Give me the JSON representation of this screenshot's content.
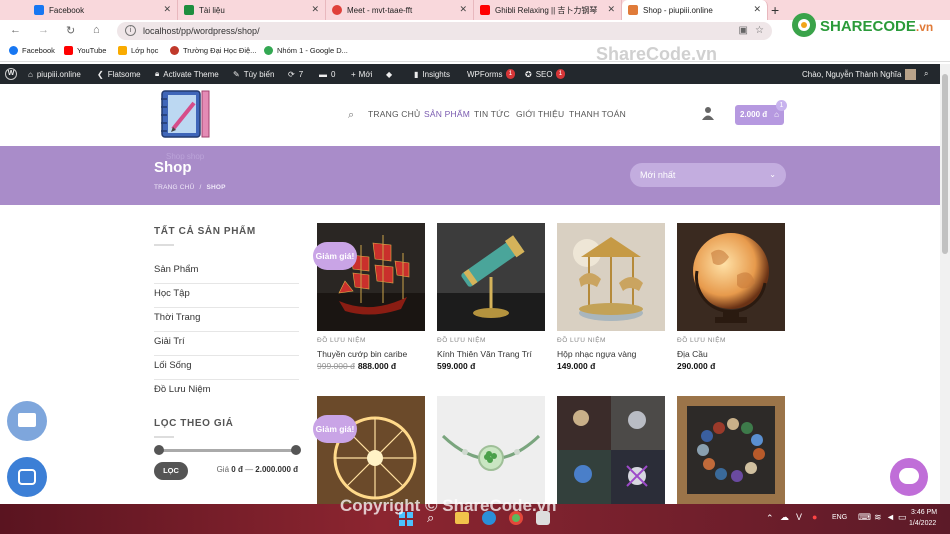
{
  "browser": {
    "tabs": [
      {
        "label": "Facebook",
        "color": "#1877f2"
      },
      {
        "label": "Tài liệu",
        "color": "#1e8e3e"
      },
      {
        "label": "Meet - mvt-taae-fft",
        "color": "#e0403a"
      },
      {
        "label": "Ghibli Relaxing || 吉卜力钢琴",
        "color": "#ff0000"
      },
      {
        "label": "Shop - piupiii.online",
        "color": "#e07b39"
      }
    ],
    "url": "localhost/pp/wordpress/shop/",
    "bookmarks": [
      {
        "label": "Facebook",
        "color": "#1877f2"
      },
      {
        "label": "YouTube",
        "color": "#ff0000"
      },
      {
        "label": "Lớp học",
        "color": "#f9ab00"
      },
      {
        "label": "Trường Đại Học Điệ...",
        "color": "#c0392b"
      },
      {
        "label": "Nhóm 1 - Google D...",
        "color": "#34a853"
      }
    ]
  },
  "wpadmin": {
    "site": "piupiii.online",
    "flatsome": "Flatsome",
    "activate": "Activate Theme",
    "customize": "Tùy biến",
    "updates": "7",
    "comments": "0",
    "new": "Mới",
    "insights": "Insights",
    "wpforms": "WPForms",
    "wpforms_count": "1",
    "seo": "SEO",
    "seo_count": "1",
    "greeting": "Chào, Nguyễn Thành Nghĩa"
  },
  "header": {
    "nav": [
      "TRANG CHỦ",
      "SẢN PHẨM",
      "TIN TỨC",
      "GIỚI THIỆU",
      "THANH TOÁN"
    ],
    "cart_total": "2.000 đ",
    "cart_count": "1"
  },
  "banner": {
    "bg_text": "Shop shop",
    "title": "Shop",
    "breadcrumb_home": "TRANG CHỦ",
    "breadcrumb_sep": "/",
    "breadcrumb_current": "SHOP",
    "sort_value": "Mới nhất"
  },
  "sidebar": {
    "categories_title": "TẤT CẢ SẢN PHẨM",
    "categories": [
      "Sản Phẩm",
      "Học Tập",
      "Thời Trang",
      "Giải Trí",
      "Lối Sống",
      "Đồ Lưu Niệm"
    ],
    "filter_title": "LỌC THEO GIÁ",
    "filter_button": "LỌC",
    "price_label": "Giá",
    "price_min": "0 đ",
    "price_dash": "—",
    "price_max": "2.000.000 đ"
  },
  "products": [
    {
      "category": "ĐỒ LƯU NIỆM",
      "name": "Thuyền cướp bin caribe",
      "old_price": "999.000 đ",
      "price": "888.000 đ",
      "sale": "Giảm giá!"
    },
    {
      "category": "ĐỒ LƯU NIỆM",
      "name": "Kính Thiên Văn Trang Trí",
      "old_price": "",
      "price": "599.000 đ",
      "sale": ""
    },
    {
      "category": "ĐỒ LƯU NIỆM",
      "name": "Hộp nhạc ngựa vàng",
      "old_price": "",
      "price": "149.000 đ",
      "sale": ""
    },
    {
      "category": "ĐỒ LƯU NIỆM",
      "name": "Địa Cầu",
      "old_price": "",
      "price": "290.000 đ",
      "sale": ""
    },
    {
      "sale": "Giảm giá!"
    }
  ],
  "taskbar": {
    "lang": "ENG",
    "time": "3:46 PM",
    "date": "1/4/2022"
  },
  "watermark": {
    "top": "ShareCode.vn",
    "bottom": "Copyright © ShareCode.vn",
    "logo": "SHARECODE.vn"
  }
}
